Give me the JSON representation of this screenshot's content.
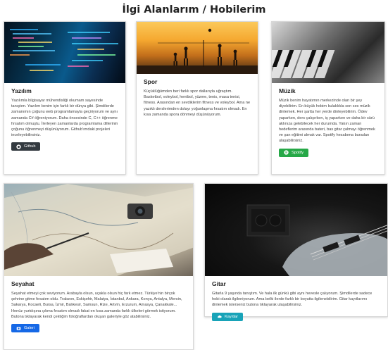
{
  "page_title": "İlgi Alanlarım / Hobilerim",
  "cards": {
    "yazilim": {
      "title": "Yazılım",
      "text": "Yazılımla bilgisayar mühendisliği okumam sayesinde tanıştım. Yazılım benim için farklı bir dünya gibi. Şimdilerde zamanımın çoğunu web programlamayla geçiriyorum ve aynı zamanda C# öğreniyorum. Daha öncesinde C, C++ öğrenme fırsatım olmuştu. İlerleyen zamanlarda programlama dillerinin çoğunu öğrenmeyi düşünüyorum. Github'ımdaki projeleri inceleyebilirsiniz.",
      "button_label": "Github",
      "button_icon": "github-icon"
    },
    "spor": {
      "title": "Spor",
      "text": "Küçüklüğümden beri farklı spor dallarıyla uğraştım. Basketbol, voleybol, hentbol, yüzme, tenis, masa tenisi, fitness. Arasından en sevdiklerim fitness ve voleybol. Ama ne yazıklı derslerimden dolayı yoğunlaşma fırsatım olmadı. En kısa zamanda spora dönmeyi düşünüyorum."
    },
    "muzik": {
      "title": "Müzik",
      "text": "Müzik benim hayatımın merkezinde olan bir şey diyebilirim. En büyük hobim kulaklıkla son ses müzik dinlemek. Her şartta her yerde dinleyebilirim. Ödev yaparken, ders çalışırken, iş yaparken ve daha bir sürü aklınıza gelebilecek her durumda. Yakın zaman hedeflerim arasında bateri, bas gitar çalmayı öğrenmek ve şan eğitimi almak var. Spotify hesabıma buradan ulaşabilirsiniz.",
      "button_label": "Spotify",
      "button_icon": "spotify-icon"
    },
    "seyahat": {
      "title": "Seyahat",
      "text": "Seyahat etmeyi çok seviyorum. Arabayla olsun, uçakla olsun hiç fark etmez. Türkiye'nin birçok şehrine gitme fırsatım oldu. Trabzon, Eskişehir, Malatya, İstanbul, Ankara, Konya, Antalya, Mersin, Sakarya, Kocaeli, Bursa, İzmir, Balıkesir, Samsun, Rize, Artvin, Erzurum, Amasya, Çanakkale... Henüz yurtdışına çıkma fırsatım olmadı fakat en kısa zamanda farklı ülkeleri görmek istiyorum. Butona tıklayarak kendi çektiğim fotoğraflardan oluşan galeriyle göz atabilirsiniz.",
      "button_label": "Galeri",
      "button_icon": "gallery-icon"
    },
    "gitar": {
      "title": "Gitar",
      "text": "Gitarla 9 yaşında tanıştım. Ve hala ilk günkü gibi aynı hevesle çalıyorum. Şimdilerde sadece hobi olarak ilgileniyorum. Ama belki ilerde farklı bir boyutta ilgilenebilirim. Gitar kayıtlarımı dinlemek isterseniz butona tıklayarak ulaşabilirsiniz.",
      "button_label": "Kayıtlar",
      "button_icon": "cloud-icon"
    }
  }
}
